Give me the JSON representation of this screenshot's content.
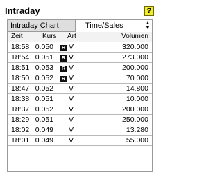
{
  "title": "Intraday",
  "help_label": "?",
  "tabs": {
    "chart_label": "Intraday Chart",
    "sales_label": "Time/Sales",
    "spinner_up": "▲",
    "spinner_down": "▼"
  },
  "columns": {
    "time": "Zeit",
    "price": "Kurs",
    "type": "Art",
    "volume": "Volumen"
  },
  "rows": [
    {
      "time": "18:58",
      "price": "0.050",
      "flag": "R",
      "type": "V",
      "volume": "320.000"
    },
    {
      "time": "18:54",
      "price": "0.051",
      "flag": "R",
      "type": "V",
      "volume": "273.000"
    },
    {
      "time": "18:51",
      "price": "0.053",
      "flag": "R",
      "type": "V",
      "volume": "200.000"
    },
    {
      "time": "18:50",
      "price": "0.052",
      "flag": "R",
      "type": "V",
      "volume": "70.000"
    },
    {
      "time": "18:47",
      "price": "0.052",
      "flag": "",
      "type": "V",
      "volume": "14.800"
    },
    {
      "time": "18:38",
      "price": "0.051",
      "flag": "",
      "type": "V",
      "volume": "10.000"
    },
    {
      "time": "18:37",
      "price": "0.052",
      "flag": "",
      "type": "V",
      "volume": "200.000"
    },
    {
      "time": "18:29",
      "price": "0.051",
      "flag": "",
      "type": "V",
      "volume": "250.000"
    },
    {
      "time": "18:02",
      "price": "0.049",
      "flag": "",
      "type": "V",
      "volume": "13.280"
    },
    {
      "time": "18:01",
      "price": "0.049",
      "flag": "",
      "type": "V",
      "volume": "55.000"
    }
  ]
}
